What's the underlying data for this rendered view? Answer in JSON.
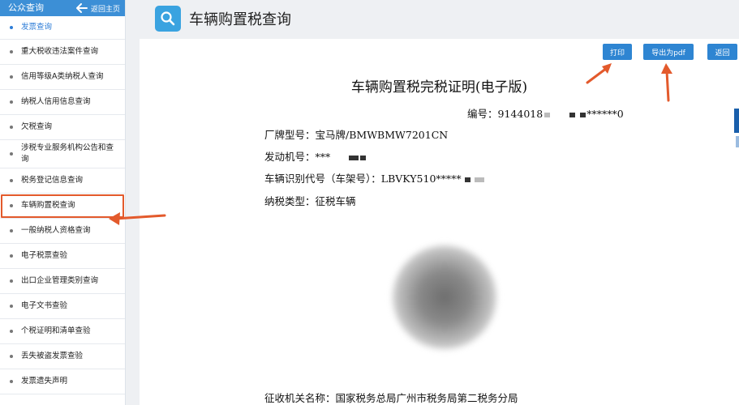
{
  "sidebar": {
    "title": "公众查询",
    "back_label": "返回主页",
    "items": [
      {
        "label": "发票查询"
      },
      {
        "label": "重大税收违法案件查询"
      },
      {
        "label": "信用等级A类纳税人查询"
      },
      {
        "label": "纳税人信用信息查询"
      },
      {
        "label": "欠税查询"
      },
      {
        "label": "涉税专业服务机构公告和查询"
      },
      {
        "label": "税务登记信息查询"
      },
      {
        "label": "车辆购置税查询"
      },
      {
        "label": "一般纳税人资格查询"
      },
      {
        "label": "电子税票查验"
      },
      {
        "label": "出口企业管理类别查询"
      },
      {
        "label": "电子文书查验"
      },
      {
        "label": "个税证明和清单查验"
      },
      {
        "label": "丢失被盗发票查验"
      },
      {
        "label": "发票遗失声明"
      }
    ]
  },
  "main": {
    "title": "车辆购置税查询",
    "buttons": {
      "print": "打印",
      "export_pdf": "导出为pdf",
      "back": "返回"
    }
  },
  "certificate": {
    "title": "车辆购置税完税证明(电子版)",
    "number_label": "编号：",
    "number_prefix": "9144018",
    "number_suffix": "******0",
    "brand_model_label": "厂牌型号：",
    "brand_model_value": "宝马牌/BMWBMW7201CN",
    "engine_label": "发动机号：",
    "engine_value": "***",
    "vin_label": "车辆识别代号（车架号）：",
    "vin_value": "LBVKY510*****",
    "tax_type_label": "纳税类型：",
    "tax_type_value": "征税车辆",
    "authority_label": "征收机关名称：",
    "authority_value": "国家税务总局广州市税务局第二税务分局"
  },
  "colors": {
    "sidebar_header": "#3c8fd6",
    "button": "#2e85d2",
    "active_link": "#2e7dd7",
    "annotation": "#e35a2c",
    "title_icon": "#3aa3e0"
  }
}
